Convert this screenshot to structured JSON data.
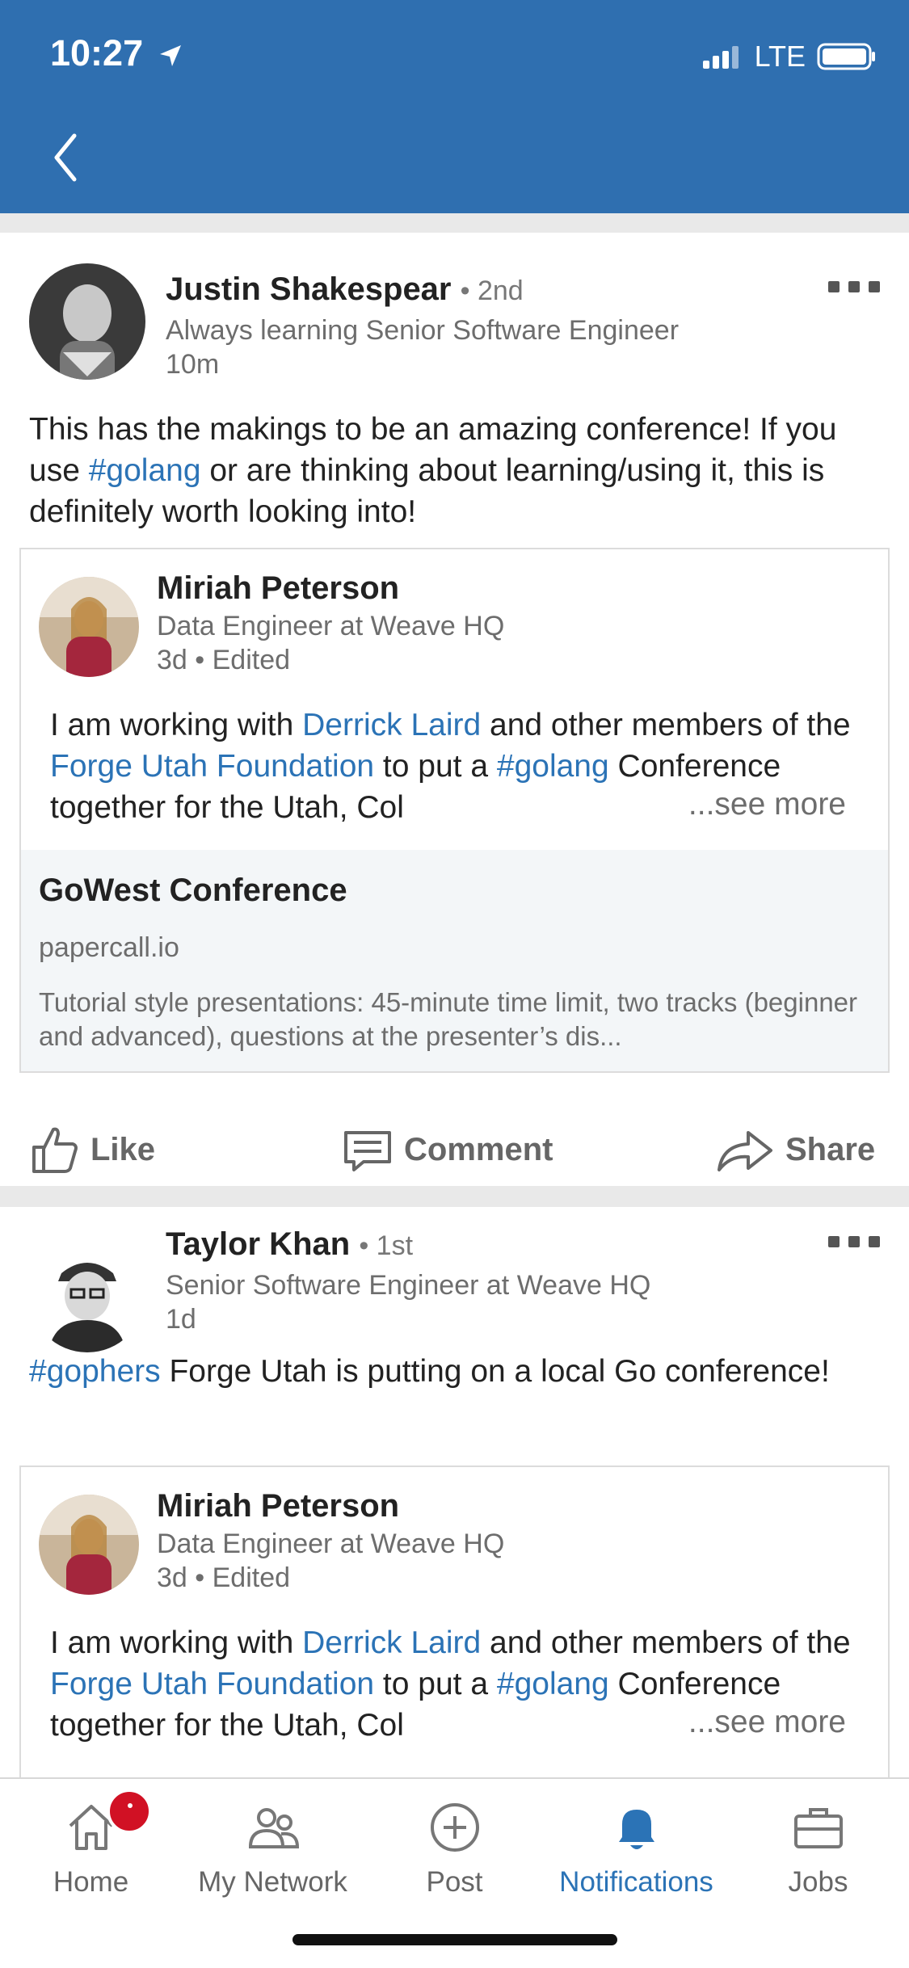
{
  "status": {
    "time": "10:27",
    "network": "LTE"
  },
  "posts": [
    {
      "author": "Justin Shakespear",
      "degree": "• 2nd",
      "headline": "Always learning Senior Software Engineer",
      "time": "10m",
      "text_parts": [
        "This has the makings to be an amazing conference! If you use ",
        "#golang",
        " or are thinking about learning/using it, this is definitely worth looking into!"
      ],
      "shared": {
        "author": "Miriah Peterson",
        "headline": "Data Engineer at Weave HQ",
        "time": "3d • Edited",
        "text_parts": [
          "I am working with ",
          "Derrick Laird",
          " and other members of the ",
          "Forge Utah Foundation",
          " to put a ",
          "#golang",
          " Conference together for the Utah, Col"
        ],
        "see_more": "...see more",
        "article": {
          "title": "GoWest Conference",
          "domain": "papercall.io",
          "description": "Tutorial style presentations: 45-minute time limit, two tracks (beginner and advanced), questions at the presenter’s dis..."
        }
      }
    },
    {
      "author": "Taylor Khan",
      "degree": "• 1st",
      "headline": "Senior Software Engineer at Weave HQ",
      "time": "1d",
      "text_parts": [
        "#gophers",
        " Forge Utah is putting on a local Go conference!"
      ],
      "shared": {
        "author": "Miriah Peterson",
        "headline": "Data Engineer at Weave HQ",
        "time": "3d • Edited",
        "text_parts": [
          "I am working with ",
          "Derrick Laird",
          " and other members of the ",
          "Forge Utah Foundation",
          " to put a ",
          "#golang",
          " Conference together for the Utah, Col"
        ],
        "see_more": "...see more"
      }
    }
  ],
  "actions": {
    "like": "Like",
    "comment": "Comment",
    "share": "Share"
  },
  "tabs": [
    {
      "label": "Home",
      "icon": "home-icon"
    },
    {
      "label": "My Network",
      "icon": "network-icon"
    },
    {
      "label": "Post",
      "icon": "post-icon"
    },
    {
      "label": "Notifications",
      "icon": "bell-icon",
      "active": true
    },
    {
      "label": "Jobs",
      "icon": "briefcase-icon"
    }
  ],
  "colors": {
    "brand": "#2f6fb0",
    "link": "#2b73b6",
    "badge": "#d11124"
  }
}
